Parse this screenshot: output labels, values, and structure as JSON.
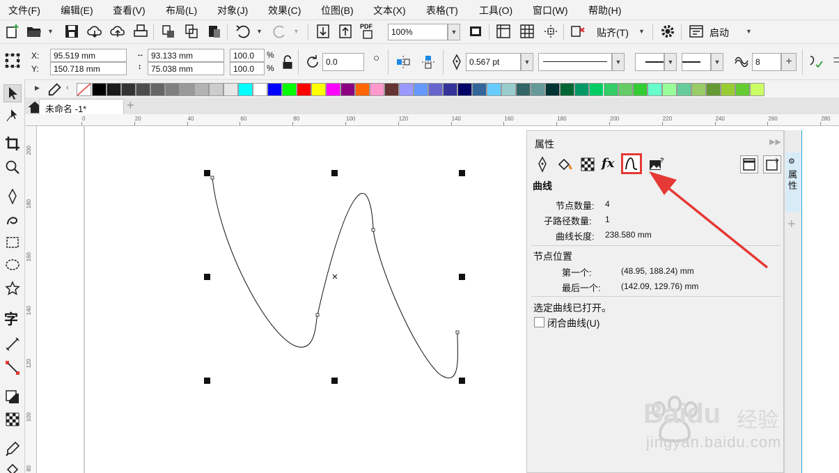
{
  "menu": [
    "文件(F)",
    "编辑(E)",
    "查看(V)",
    "布局(L)",
    "对象(J)",
    "效果(C)",
    "位图(B)",
    "文本(X)",
    "表格(T)",
    "工具(O)",
    "窗口(W)",
    "帮助(H)"
  ],
  "toolbar": {
    "zoom_value": "100%",
    "snap_label": "贴齐(T)",
    "launch_label": "启动",
    "pdf_label": "PDF"
  },
  "property_bar": {
    "x_label": "X:",
    "y_label": "Y:",
    "x_value": "95.519 mm",
    "y_value": "150.718 mm",
    "width_value": "93.133 mm",
    "height_value": "75.038 mm",
    "scale_x": "100.0",
    "scale_y": "100.0",
    "percent": "%",
    "rotation": "0.0",
    "outline_width": "0.567 pt",
    "smoothing": "8"
  },
  "palette_colors": [
    "#000000",
    "#1a1a1a",
    "#333333",
    "#4d4d4d",
    "#666666",
    "#808080",
    "#999999",
    "#b3b3b3",
    "#cccccc",
    "#e6e6e6",
    "#00ffff",
    "#ffffff",
    "#0000ff",
    "#00ff00",
    "#ff0000",
    "#ffff00",
    "#ff00ff",
    "#8b0080",
    "#ff6600",
    "#ff99cc",
    "#663333",
    "#9999ff",
    "#6699ff",
    "#6666cc",
    "#333399",
    "#000066",
    "#336699",
    "#66ccff",
    "#99cccc",
    "#336666",
    "#669999",
    "#003333",
    "#006633",
    "#009966",
    "#00cc66",
    "#33cc66",
    "#66cc66",
    "#33cc33",
    "#66ffcc",
    "#99ff99",
    "#66cc99",
    "#99cc66",
    "#669933",
    "#99cc33",
    "#66cc33",
    "#ccff66"
  ],
  "document_tab": "未命名 -1*",
  "ruler": {
    "top_ticks": [
      "0",
      "20",
      "40",
      "60",
      "80",
      "100",
      "120",
      "140",
      "160",
      "180",
      "200",
      "220",
      "240",
      "260",
      "280"
    ],
    "left_ticks": [
      "200",
      "180",
      "160",
      "140",
      "120",
      "100",
      "80"
    ]
  },
  "docker": {
    "title": "属性",
    "section_curve": "曲线",
    "node_count_label": "节点数量:",
    "node_count_value": "4",
    "subpath_label": "子路径数量:",
    "subpath_value": "1",
    "length_label": "曲线长度:",
    "length_value": "238.580 mm",
    "node_pos_label": "节点位置",
    "first_label": "第一个:",
    "first_value": "(48.95, 188.24) mm",
    "last_label": "最后一个:",
    "last_value": "(142.09, 129.76) mm",
    "status": "选定曲线已打开。",
    "close_curve_label": "闭合曲线(U)",
    "side_tab": "属性"
  },
  "watermark": {
    "brand": "Baidu",
    "brand_cn": "经验",
    "url": "jingyan.baidu.com"
  },
  "colors": {
    "highlight": "#e53935",
    "docker_accent": "#1aa7e0",
    "selected_swatch": "#33cc66"
  }
}
